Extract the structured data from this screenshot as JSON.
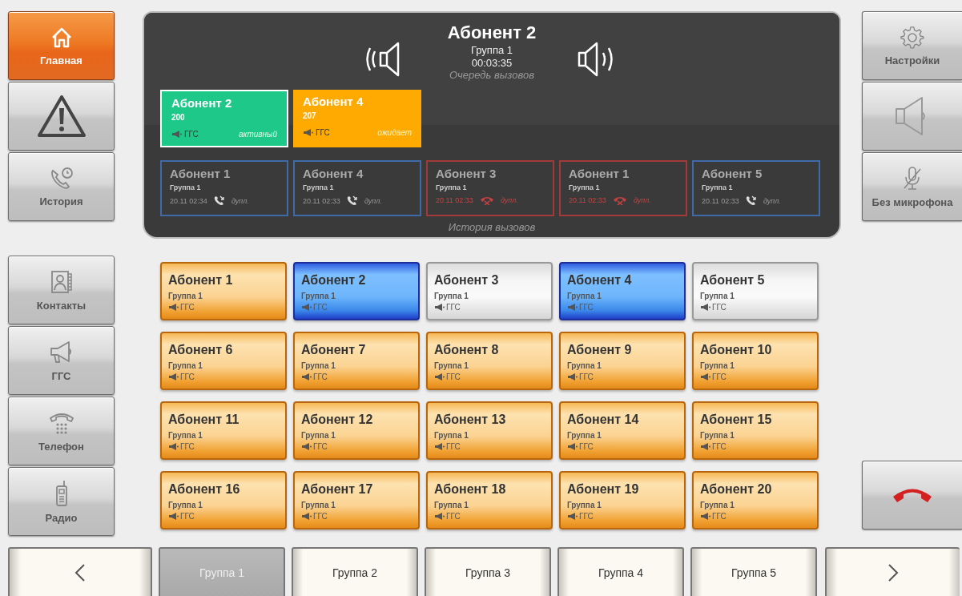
{
  "left_nav": [
    {
      "label": "Главная",
      "kind": "home",
      "selected": true
    },
    {
      "kind": "alert",
      "selected": false
    },
    {
      "label": "История",
      "kind": "history",
      "selected": false
    }
  ],
  "left_nav_bottom": [
    {
      "label": "Контакты",
      "kind": "contacts",
      "selected": false
    },
    {
      "label": "ГГС",
      "kind": "megaphone",
      "selected": false
    },
    {
      "label": "Телефон",
      "kind": "phone",
      "selected": false
    },
    {
      "label": "Радио",
      "kind": "radio",
      "selected": false
    }
  ],
  "call": {
    "name": "Абонент 2",
    "group": "Группа 1",
    "duration": "00:03:35",
    "queue_label": "Очередь вызовов"
  },
  "queue": [
    {
      "name": "Абонент 2",
      "number": "200",
      "line": "ГГС",
      "status": "активный",
      "kind": "active"
    },
    {
      "name": "Абонент 4",
      "number": "207",
      "line": "ГГС",
      "status": "ожидает",
      "kind": "waiting"
    }
  ],
  "history": [
    {
      "name": "Абонент 1",
      "group": "Группа 1",
      "time": "20.11 02:34",
      "mode": "дупл.",
      "missed": false
    },
    {
      "name": "Абонент 4",
      "group": "Группа 1",
      "time": "20.11 02:33",
      "mode": "дупл.",
      "missed": false
    },
    {
      "name": "Абонент 3",
      "group": "Группа 1",
      "time": "20.11 02:33",
      "mode": "дупл.",
      "missed": true
    },
    {
      "name": "Абонент 1",
      "group": "Группа 1",
      "time": "20.11 02:33",
      "mode": "дупл.",
      "missed": true
    },
    {
      "name": "Абонент 5",
      "group": "Группа 1",
      "time": "20.11 02:33",
      "mode": "дупл.",
      "missed": false
    }
  ],
  "history_label": "История вызовов",
  "right_nav": [
    {
      "label": "Настройки",
      "kind": "settings"
    },
    {
      "kind": "speaker"
    },
    {
      "label": "Без микрофона",
      "kind": "mic-off"
    }
  ],
  "subscribers": [
    {
      "name": "Абонент 1",
      "group": "Группа 1",
      "line": "ГГС",
      "kind": "ready"
    },
    {
      "name": "Абонент 2",
      "group": "Группа 1",
      "line": "ГГС",
      "kind": "active"
    },
    {
      "name": "Абонент 3",
      "group": "Группа 1",
      "line": "ГГС",
      "kind": "idle"
    },
    {
      "name": "Абонент 4",
      "group": "Группа 1",
      "line": "ГГС",
      "kind": "active"
    },
    {
      "name": "Абонент 5",
      "group": "Группа 1",
      "line": "ГГС",
      "kind": "idle"
    },
    {
      "name": "Абонент 6",
      "group": "Группа 1",
      "line": "ГГС",
      "kind": "ready"
    },
    {
      "name": "Абонент 7",
      "group": "Группа 1",
      "line": "ГГС",
      "kind": "ready"
    },
    {
      "name": "Абонент 8",
      "group": "Группа 1",
      "line": "ГГС",
      "kind": "ready"
    },
    {
      "name": "Абонент 9",
      "group": "Группа 1",
      "line": "ГГС",
      "kind": "ready"
    },
    {
      "name": "Абонент 10",
      "group": "Группа 1",
      "line": "ГГС",
      "kind": "ready"
    },
    {
      "name": "Абонент 11",
      "group": "Группа 1",
      "line": "ГГС",
      "kind": "ready"
    },
    {
      "name": "Абонент 12",
      "group": "Группа 1",
      "line": "ГГС",
      "kind": "ready"
    },
    {
      "name": "Абонент 13",
      "group": "Группа 1",
      "line": "ГГС",
      "kind": "ready"
    },
    {
      "name": "Абонент 14",
      "group": "Группа 1",
      "line": "ГГС",
      "kind": "ready"
    },
    {
      "name": "Абонент 15",
      "group": "Группа 1",
      "line": "ГГС",
      "kind": "ready"
    },
    {
      "name": "Абонент 16",
      "group": "Группа 1",
      "line": "ГГС",
      "kind": "ready"
    },
    {
      "name": "Абонент 17",
      "group": "Группа 1",
      "line": "ГГС",
      "kind": "ready"
    },
    {
      "name": "Абонент 18",
      "group": "Группа 1",
      "line": "ГГС",
      "kind": "ready"
    },
    {
      "name": "Абонент 19",
      "group": "Группа 1",
      "line": "ГГС",
      "kind": "ready"
    },
    {
      "name": "Абонент 20",
      "group": "Группа 1",
      "line": "ГГС",
      "kind": "ready"
    }
  ],
  "group_tabs": [
    {
      "label": "Группа 1",
      "selected": true
    },
    {
      "label": "Группа 2",
      "selected": false
    },
    {
      "label": "Группа 3",
      "selected": false
    },
    {
      "label": "Группа 4",
      "selected": false
    },
    {
      "label": "Группа 5",
      "selected": false
    }
  ]
}
